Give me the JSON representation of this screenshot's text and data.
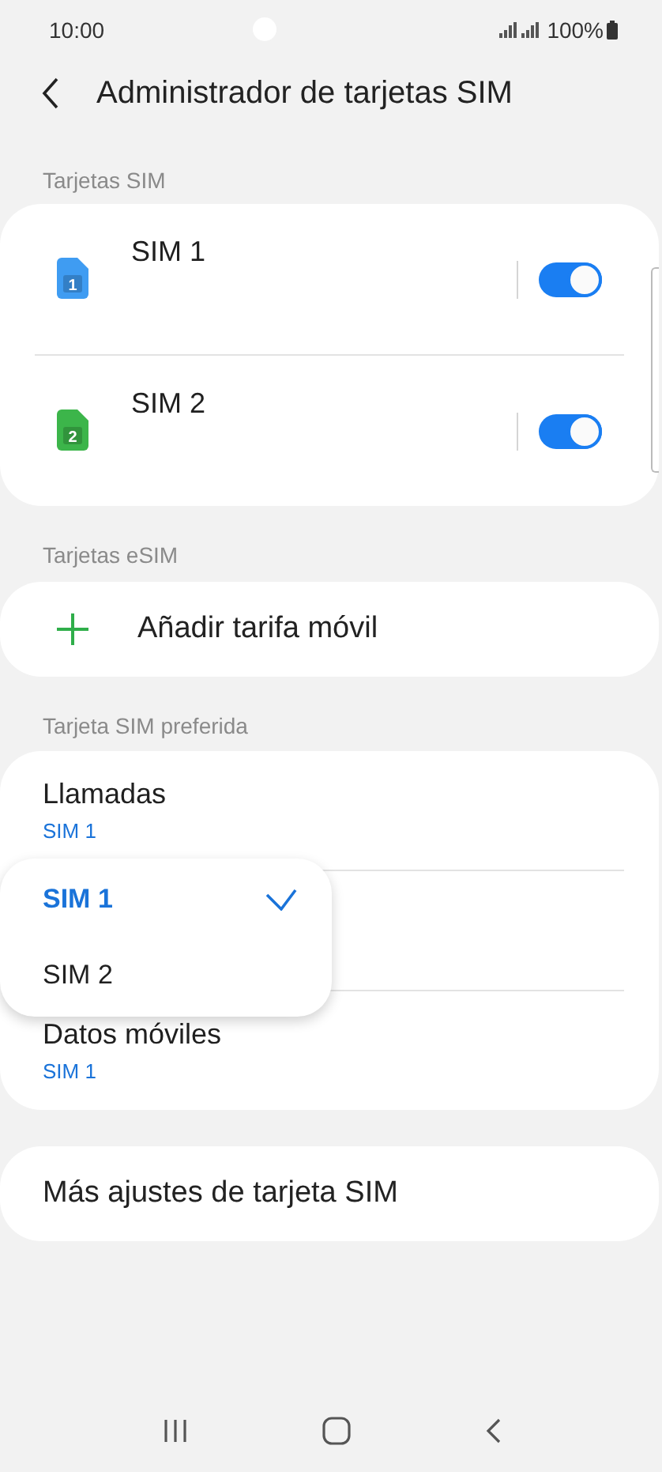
{
  "status_bar": {
    "time": "10:00",
    "battery": "100%"
  },
  "header": {
    "title": "Administrador de tarjetas SIM"
  },
  "sim_cards": {
    "label": "Tarjetas SIM",
    "items": [
      {
        "name": "SIM 1",
        "badge": "1",
        "color": "#3f9cf2",
        "on": true
      },
      {
        "name": "SIM 2",
        "badge": "2",
        "color": "#3cb54a",
        "on": true
      }
    ]
  },
  "esim": {
    "label": "Tarjetas eSIM",
    "action": "Añadir tarifa móvil"
  },
  "preferred": {
    "label": "Tarjeta SIM preferida",
    "rows": [
      {
        "title": "Llamadas",
        "value": "SIM 1"
      },
      {
        "title": "Datos móviles",
        "value": "SIM 1"
      }
    ]
  },
  "popup": {
    "options": [
      {
        "label": "SIM 1",
        "selected": true
      },
      {
        "label": "SIM 2",
        "selected": false
      }
    ]
  },
  "more": {
    "label": "Más ajustes de tarjeta SIM"
  }
}
